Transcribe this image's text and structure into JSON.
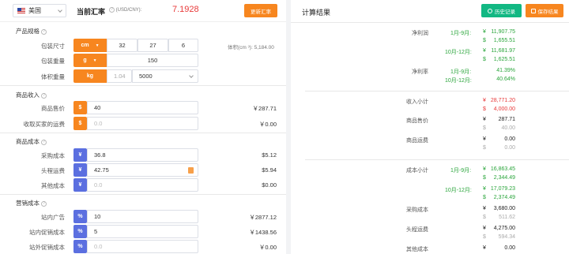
{
  "header": {
    "country": "美国",
    "rate_title": "当前汇率",
    "rate_unit": "(USD/CNY):",
    "rate_value": "7.1928",
    "update_button": "更新汇率"
  },
  "spec": {
    "title": "产品规格",
    "size_label": "包装尺寸",
    "size_unit": "cm",
    "size_values": [
      "32",
      "27",
      "6"
    ],
    "volume_text": "体积(cm ³): 5,184.00",
    "weight_label": "包装重量",
    "weight_unit": "g",
    "weight_value": "150",
    "vol_weight_label": "体积重量",
    "vol_weight_unit": "kg",
    "vol_weight_value": "1.04",
    "vol_weight_divisor": "5000"
  },
  "income": {
    "title": "商品收入",
    "price_label": "商品售价",
    "price_prefix": "$",
    "price_value": "40",
    "price_result": "￥287.71",
    "shipping_label": "收取买家的运费",
    "shipping_prefix": "$",
    "shipping_placeholder": "0.0",
    "shipping_result": "￥0.00"
  },
  "cost": {
    "title": "商品成本",
    "purchase_label": "采购成本",
    "purchase_prefix": "¥",
    "purchase_value": "36.8",
    "purchase_result": "$5.12",
    "firstleg_label": "头程运费",
    "firstleg_prefix": "¥",
    "firstleg_value": "42.75",
    "firstleg_result": "$5.94",
    "other_label": "其他成本",
    "other_prefix": "¥",
    "other_placeholder": "0.0",
    "other_result": "$0.00"
  },
  "marketing": {
    "title": "营销成本",
    "ads_label": "站内广告",
    "ads_prefix": "%",
    "ads_value": "10",
    "ads_result": "￥2877.12",
    "promo_label": "站内促销成本",
    "promo_prefix": "%",
    "promo_value": "5",
    "promo_result": "￥1438.56",
    "offsite_label": "站外促销成本",
    "offsite_prefix": "%",
    "offsite_placeholder": "0.0",
    "offsite_result": "￥0.00"
  },
  "result": {
    "title": "计算结果",
    "history_button": "历史记录",
    "save_button": "保存结果",
    "net_profit_label": "净利润",
    "p1": "1月-9月:",
    "p2": "10月-12月:",
    "np_p1_cny": "11,907.75",
    "np_p1_usd": "1,655.51",
    "np_p2_cny": "11,681.97",
    "np_p2_usd": "1,625.51",
    "margin_label": "净利率",
    "margin_p1": "41.39%",
    "margin_p2": "40.64%",
    "income_total_label": "收入小计",
    "income_total_cny": "28,771.20",
    "income_total_usd": "4,000.00",
    "price_label": "商品售价",
    "price_cny": "287.71",
    "price_usd": "40.00",
    "ship_label": "商品运费",
    "ship_cny": "0.00",
    "ship_usd": "0.00",
    "cost_total_label": "成本小计",
    "cost_p1_cny": "16,863.45",
    "cost_p1_usd": "2,344.49",
    "cost_p2_cny": "17,079.23",
    "cost_p2_usd": "2,374.49",
    "purchase_label": "采购成本",
    "purchase_cny": "3,680.00",
    "purchase_usd": "511.62",
    "firstleg_label": "头程运费",
    "firstleg_cny": "4,275.00",
    "firstleg_usd": "594.34",
    "other_label": "其他成本",
    "other_cny": "0.00",
    "yen": "¥",
    "usd": "$"
  }
}
